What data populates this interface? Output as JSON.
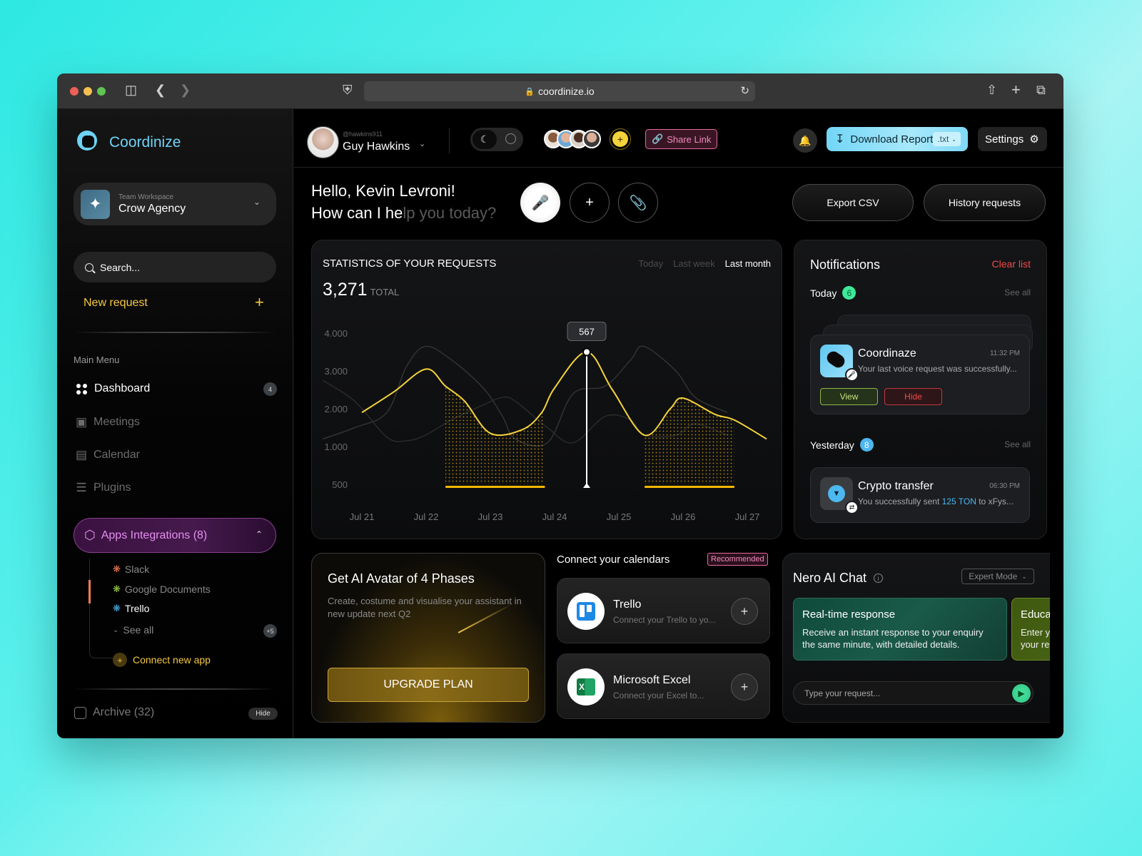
{
  "browser": {
    "url": "coordinize.io"
  },
  "sidebar": {
    "brand": "Coordinize",
    "workspace": {
      "label": "Team Workspace",
      "name": "Crow Agency"
    },
    "search_placeholder": "Search...",
    "new_request_label": "New request",
    "main_menu_label": "Main Menu",
    "menu": [
      {
        "label": "Dashboard",
        "icon": "dashboard-icon",
        "active": true,
        "badge": "4"
      },
      {
        "label": "Meetings",
        "icon": "video-camera-icon"
      },
      {
        "label": "Calendar",
        "icon": "calendar-icon"
      },
      {
        "label": "Plugins",
        "icon": "layers-icon"
      }
    ],
    "apps_integrations": {
      "label": "Apps Integrations (8)",
      "items": [
        {
          "label": "Slack",
          "color": "#f07e55"
        },
        {
          "label": "Google Documents",
          "color": "#9bd150"
        },
        {
          "label": "Trello",
          "color": "#4db7f0",
          "active": true
        }
      ],
      "see_all_label": "See all",
      "see_all_badge": "+5",
      "connect_label": "Connect new app"
    },
    "archive": {
      "label": "Archive (32)",
      "hide_label": "Hide"
    }
  },
  "topbar": {
    "user": {
      "handle": "@hawkins911",
      "name": "Guy Hawkins"
    },
    "share_link_label": "Share Link",
    "download_label": "Download Report",
    "download_format": ".txt",
    "settings_label": "Settings"
  },
  "greeting": {
    "line1": "Hello, Kevin Levroni!",
    "line2_bright": "How can I he",
    "line2_dim": "lp you today?",
    "export_csv_label": "Export CSV",
    "history_label": "History requests"
  },
  "stats": {
    "title": "STATISTICS OF YOUR REQUESTS",
    "total": "3,271",
    "total_label": "TOTAL",
    "ranges": [
      "Today",
      "Last week",
      "Last month"
    ],
    "active_range": "Last month"
  },
  "chart_data": {
    "type": "line",
    "title": "STATISTICS OF YOUR REQUESTS",
    "xlabel": "",
    "ylabel": "",
    "categories": [
      "Jul 21",
      "Jul 22",
      "Jul 23",
      "Jul 24",
      "Jul 25",
      "Jul 26",
      "Jul 27"
    ],
    "y_ticks": [
      "4.000",
      "3.000",
      "2.000",
      "1.000",
      "500"
    ],
    "y_tick_values": [
      4000,
      3000,
      2000,
      1000,
      500
    ],
    "x_positions": [
      0,
      0.5,
      1,
      1.3,
      1.6,
      2,
      2.5,
      2.8,
      3,
      3.5,
      3.9,
      4.4,
      4.8,
      5,
      5.5,
      5.8,
      6.3
    ],
    "series": [
      {
        "name": "requests",
        "color": "#f5d33a",
        "highlight": true,
        "values": [
          1900,
          2450,
          3050,
          2600,
          2200,
          1350,
          1450,
          1900,
          2550,
          3500,
          2500,
          1300,
          2000,
          2280,
          1850,
          1700,
          1200
        ]
      },
      {
        "name": "background-1",
        "color": "#333",
        "values": [
          1200,
          1500,
          1900,
          3100,
          3650,
          3300,
          2550,
          1800,
          1200,
          1100,
          2400,
          2600,
          3300,
          3650,
          3000,
          2300,
          1900
        ]
      },
      {
        "name": "background-2",
        "color": "#2a2a2a",
        "values": [
          2750,
          2200,
          1250,
          1150,
          1300,
          1700,
          2100,
          2300,
          2200,
          1500,
          1100,
          1800,
          1700,
          1300,
          1300,
          1600,
          1300
        ]
      }
    ],
    "highlight_ranges": [
      [
        1.3,
        2.85
      ],
      [
        4.4,
        5.8
      ]
    ],
    "tooltip": {
      "x": 3.5,
      "label": "567"
    },
    "ylim": [
      200,
      4300
    ]
  },
  "notifications": {
    "title": "Notifications",
    "clear_label": "Clear list",
    "groups": [
      {
        "label": "Today",
        "count": "6",
        "count_color": "#3ee89a",
        "see_all": "See all",
        "item": {
          "title": "Coordinaze",
          "time": "11:32 PM",
          "message": "Your last voice request was successfully...",
          "view_label": "View",
          "hide_label": "Hide"
        }
      },
      {
        "label": "Yesterday",
        "count": "8",
        "count_color": "#4db7f0",
        "see_all": "See all",
        "item": {
          "title": "Crypto transfer",
          "time": "06:30 PM",
          "message_pre": "You successfully sent ",
          "message_hl": "125 TON",
          "message_post": " to xFys..."
        }
      }
    ]
  },
  "upgrade": {
    "title": "Get AI Avatar of 4 Phases",
    "description": "Create, costume and visualise your assistant in new update next Q2",
    "button_label": "UPGRADE PLAN"
  },
  "calendars": {
    "title": "Connect your calendars",
    "badge": "Recommended",
    "items": [
      {
        "name": "Trello",
        "description": "Connect your Trello to yo..."
      },
      {
        "name": "Microsoft Excel",
        "description": "Connect your Excel to..."
      }
    ]
  },
  "ai_chat": {
    "title": "Nero AI Chat",
    "mode": "Expert Mode",
    "cards": [
      {
        "title": "Real-time response",
        "text": "Receive an instant response to your enquiry\nthe same minute, with detailed details."
      },
      {
        "title": "Educa",
        "text": "Enter y\nyour re"
      }
    ],
    "input_placeholder": "Type your request..."
  }
}
